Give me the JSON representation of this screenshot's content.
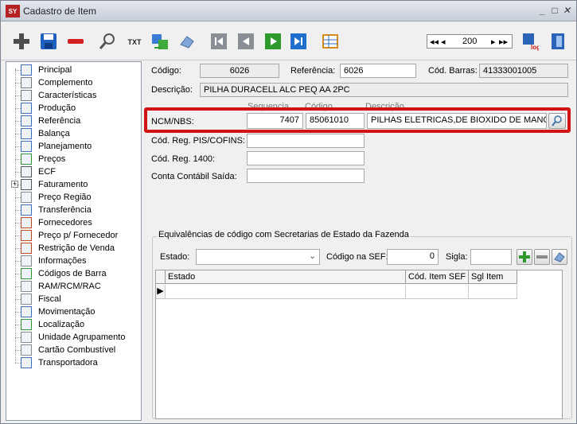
{
  "window": {
    "title": "Cadastro de Item"
  },
  "toolbar": {
    "icons": [
      "add-icon",
      "save-icon",
      "delete-icon",
      "search-icon",
      "txt-export-icon",
      "refresh-icon",
      "eraser-icon",
      "first-record-icon",
      "previous-record-icon",
      "next-record-icon",
      "last-record-icon",
      "grid-view-icon",
      "log-icon",
      "exit-icon"
    ],
    "txt_label": "TXT",
    "log_label": "log",
    "nav_first": "◂◂",
    "nav_prev": "◂",
    "nav_value": "200",
    "nav_next": "▸",
    "nav_last": "▸▸"
  },
  "tree": {
    "items": [
      {
        "label": "Principal",
        "icon": "list-icon"
      },
      {
        "label": "Complemento",
        "icon": "clip-icon"
      },
      {
        "label": "Características",
        "icon": "clip-icon"
      },
      {
        "label": "Produção",
        "icon": "production-icon"
      },
      {
        "label": "Referência",
        "icon": "reference-icon"
      },
      {
        "label": "Balança",
        "icon": "scale-icon"
      },
      {
        "label": "Planejamento",
        "icon": "planning-icon"
      },
      {
        "label": "Preços",
        "icon": "price-icon"
      },
      {
        "label": "ECF",
        "icon": "ecf-icon"
      },
      {
        "label": "Faturamento",
        "icon": "billing-icon"
      },
      {
        "label": "Preço Região",
        "icon": "region-price-icon"
      },
      {
        "label": "Transferência",
        "icon": "transfer-icon"
      },
      {
        "label": "Fornecedores",
        "icon": "suppliers-icon"
      },
      {
        "label": "Preço p/ Fornecedor",
        "icon": "supplier-price-icon"
      },
      {
        "label": "Restrição de Venda",
        "icon": "restriction-icon"
      },
      {
        "label": "Informações",
        "icon": "info-icon"
      },
      {
        "label": "Códigos de Barra",
        "icon": "barcode-icon"
      },
      {
        "label": "RAM/RCM/RAC",
        "icon": "document-icon"
      },
      {
        "label": "Fiscal",
        "icon": "fiscal-icon"
      },
      {
        "label": "Movimentação",
        "icon": "movement-icon"
      },
      {
        "label": "Localização",
        "icon": "location-icon"
      },
      {
        "label": "Unidade Agrupamento",
        "icon": "grouping-icon"
      },
      {
        "label": "Cartão Combustível",
        "icon": "fuel-card-icon"
      },
      {
        "label": "Transportadora",
        "icon": "truck-icon"
      }
    ]
  },
  "form": {
    "codigo_label": "Código:",
    "codigo_value": "6026",
    "referencia_label": "Referência:",
    "referencia_value": "6026",
    "barras_label": "Cód. Barras:",
    "barras_value": "41333001005",
    "descricao_label": "Descrição:",
    "descricao_value": "PILHA DURACELL ALC PEQ AA 2PC",
    "ncm_label": "NCM/NBS:",
    "ncm_seq_header": "Sequencia",
    "ncm_codigo_header": "Código",
    "ncm_desc_header": "Descrição",
    "ncm_seq_value": "7407",
    "ncm_codigo_value": "85061010",
    "ncm_desc_value": "PILHAS ELETRICAS,DE BIOXIDO DE MANGANE",
    "pis_label": "Cód. Reg. PIS/COFINS:",
    "pis_value": "",
    "reg1400_label": "Cód. Reg. 1400:",
    "reg1400_value": "",
    "conta_label": "Conta Contábil Saída:",
    "conta_value": ""
  },
  "equivalencias": {
    "title": "Equivalências de código com Secretarias de Estado da Fazenda",
    "estado_label": "Estado:",
    "estado_value": "",
    "sef_label": "Código na SEF:",
    "sef_value": "0",
    "sigla_label": "Sigla:",
    "sigla_value": "",
    "columns": [
      "Estado",
      "Cód. Item SEF",
      "Sgl Item"
    ],
    "row_indicator": "▶"
  },
  "colors": {
    "highlight": "#d11313",
    "accent_green": "#2e9a2e",
    "accent_blue": "#1e6fd0",
    "delete_red": "#d42020"
  }
}
